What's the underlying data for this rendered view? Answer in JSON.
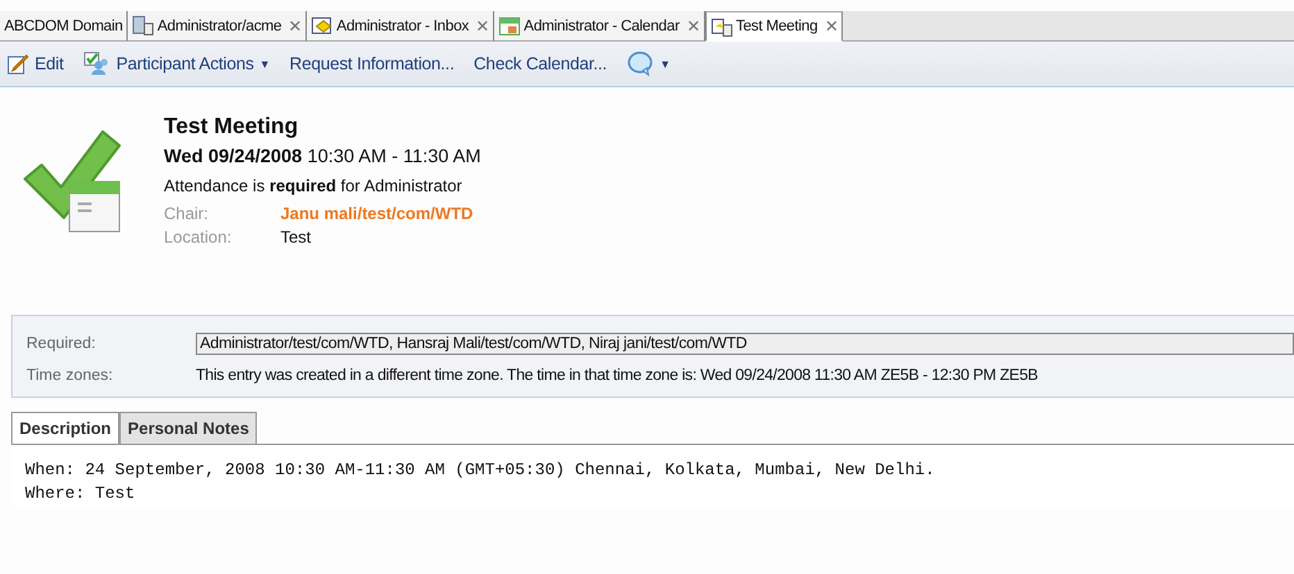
{
  "tabs": [
    {
      "label": "ABCDOM Domain",
      "kind": "domain",
      "selected": false,
      "closable": false
    },
    {
      "label": "Administrator/acme",
      "kind": "database",
      "selected": false,
      "closable": true
    },
    {
      "label": "Administrator - Inbox",
      "kind": "inbox",
      "selected": false,
      "closable": true
    },
    {
      "label": "Administrator - Calendar",
      "kind": "calendar",
      "selected": false,
      "closable": true
    },
    {
      "label": "Test Meeting",
      "kind": "document",
      "selected": true,
      "closable": true
    }
  ],
  "close_glyph": "✕",
  "toolbar": [
    {
      "kind": "edit",
      "label": "Edit",
      "dropdown": false
    },
    {
      "kind": "participants",
      "label": "Participant Actions",
      "dropdown": true
    },
    {
      "kind": "text",
      "label": "Request Information...",
      "dropdown": false
    },
    {
      "kind": "text",
      "label": "Check Calendar...",
      "dropdown": false
    },
    {
      "kind": "chat",
      "dropdown": true
    }
  ],
  "dropdown_glyph": "▼",
  "meeting": {
    "title": "Test Meeting",
    "date_bold": "Wed 09/24/2008",
    "time": "10:30 AM - 11:30 AM",
    "attendance": "Attendance is **required** for Administrator",
    "fields": [
      {
        "label": "Chair:",
        "value": "Janu mali/test/com/WTD",
        "kind": "link"
      },
      {
        "label": "Location:",
        "value": "Test",
        "kind": "plain"
      }
    ]
  },
  "details": {
    "required_label": "Required:",
    "required_value": "Administrator/test/com/WTD, Hansraj Mali/test/com/WTD, Niraj jani/test/com/WTD",
    "time_zones_label": "Time zones:",
    "time_zones_value": "This entry was created in a different time zone.  The time in that time zone is: Wed 09/24/2008 11:30 AM ZE5B - 12:30 PM ZE5B"
  },
  "section_tabs": [
    {
      "label": "Description",
      "selected": true
    },
    {
      "label": "Personal Notes",
      "selected": false
    }
  ],
  "description": [
    "When: 24 September, 2008 10:30 AM-11:30 AM (GMT+05:30) Chennai, Kolkata, Mumbai, New Delhi.",
    "Where: Test"
  ]
}
